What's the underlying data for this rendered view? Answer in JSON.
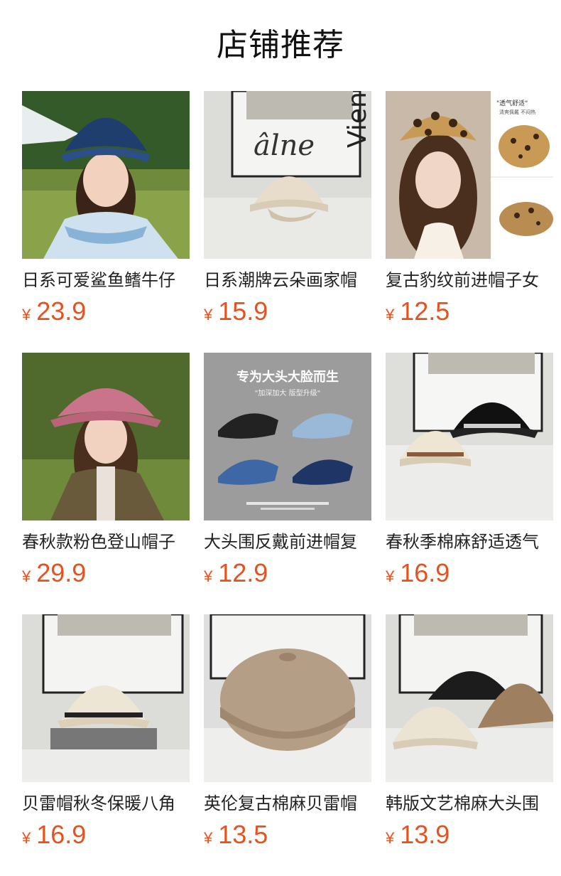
{
  "section_title": "店铺推荐",
  "products": [
    {
      "name": "日系可爱鲨鱼鳍牛仔",
      "currency": "¥",
      "price": "23.9"
    },
    {
      "name": "日系潮牌云朵画家帽",
      "currency": "¥",
      "price": "15.9"
    },
    {
      "name": "复古豹纹前进帽子女",
      "currency": "¥",
      "price": "12.5"
    },
    {
      "name": "春秋款粉色登山帽子",
      "currency": "¥",
      "price": "29.9"
    },
    {
      "name": "大头围反戴前进帽复",
      "currency": "¥",
      "price": "12.9"
    },
    {
      "name": "春秋季棉麻舒适透气",
      "currency": "¥",
      "price": "16.9"
    },
    {
      "name": "贝雷帽秋冬保暖八角",
      "currency": "¥",
      "price": "16.9"
    },
    {
      "name": "英伦复古棉麻贝雷帽",
      "currency": "¥",
      "price": "13.5"
    },
    {
      "name": "韩版文艺棉麻大头围",
      "currency": "¥",
      "price": "13.9"
    }
  ],
  "promo_image": {
    "headline": "专为大头大脸而生",
    "subline": "\"加深加大 版型升级\""
  },
  "leopard_image": {
    "caption": "\"透气舒适\"",
    "subcaption": "清爽佩戴 不闷热"
  },
  "photo_text": {
    "script": "âlne",
    "vienna": "Vien"
  }
}
